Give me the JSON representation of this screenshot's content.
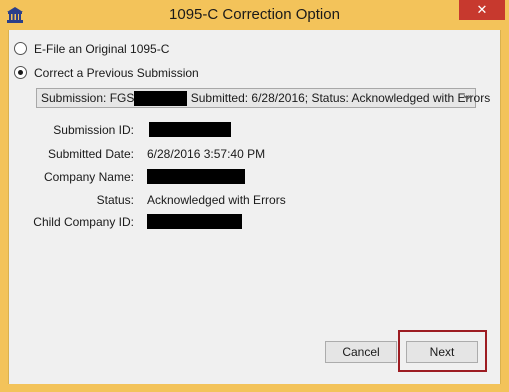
{
  "window": {
    "title": "1095-C Correction Option",
    "close_label": "✕"
  },
  "options": {
    "efile_original": "E-File an Original 1095-C",
    "correct_previous": "Correct a Previous Submission",
    "selected": "correct_previous"
  },
  "submission_select": {
    "prefix": "Submission: FGS",
    "suffix": "Submitted: 6/28/2016; Status: Acknowledged with Errors"
  },
  "details": {
    "submission_id_label": "Submission ID:",
    "submitted_date_label": "Submitted Date:",
    "submitted_date_value": "6/28/2016 3:57:40 PM",
    "company_name_label": "Company Name:",
    "status_label": "Status:",
    "status_value": "Acknowledged with Errors",
    "child_company_id_label": "Child Company ID:"
  },
  "buttons": {
    "cancel": "Cancel",
    "next": "Next"
  }
}
